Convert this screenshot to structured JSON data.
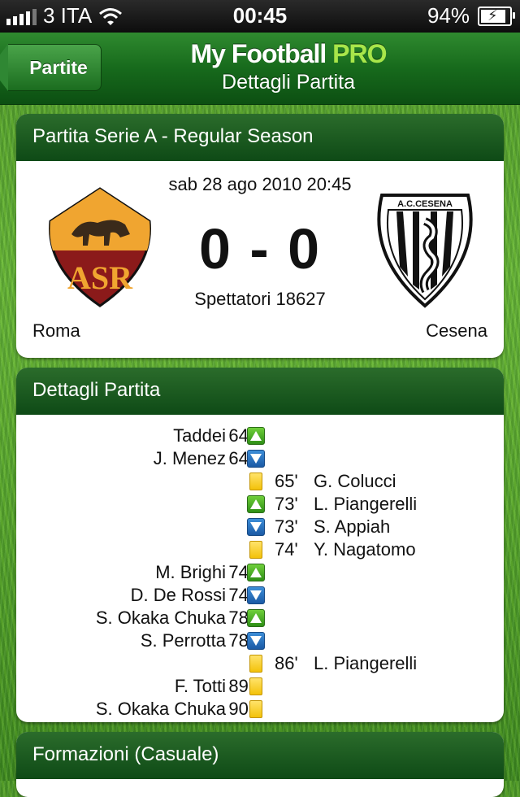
{
  "status_bar": {
    "carrier": "3 ITA",
    "time": "00:45",
    "battery": "94%",
    "battery_level": 0.94
  },
  "nav": {
    "back_label": "Partite",
    "app_name_part1": "My Football",
    "app_name_part2": "PRO",
    "subtitle": "Dettagli Partita"
  },
  "match": {
    "header": "Partita Serie A - Regular Season",
    "date": "sab 28 ago 2010 20:45",
    "score": "0 - 0",
    "spectators": "Spettatori 18627",
    "home_team": "Roma",
    "away_team": "Cesena",
    "away_logo_text": "A.C.CESENA",
    "home_logo_text": "ASR"
  },
  "details": {
    "header": "Dettagli Partita",
    "events": [
      {
        "side": "home",
        "player": "Taddei",
        "minute": "64'",
        "type": "sub-in",
        "icon": "arrow-up-icon"
      },
      {
        "side": "home",
        "player": "J. Menez",
        "minute": "64'",
        "type": "sub-out",
        "icon": "arrow-down-icon"
      },
      {
        "side": "away",
        "player": "G. Colucci",
        "minute": "65'",
        "type": "yellow",
        "icon": "yellow-card-icon"
      },
      {
        "side": "away",
        "player": "L. Piangerelli",
        "minute": "73'",
        "type": "sub-in",
        "icon": "arrow-up-icon"
      },
      {
        "side": "away",
        "player": "S. Appiah",
        "minute": "73'",
        "type": "sub-out",
        "icon": "arrow-down-icon"
      },
      {
        "side": "away",
        "player": "Y. Nagatomo",
        "minute": "74'",
        "type": "yellow",
        "icon": "yellow-card-icon"
      },
      {
        "side": "home",
        "player": "M. Brighi",
        "minute": "74'",
        "type": "sub-in",
        "icon": "arrow-up-icon"
      },
      {
        "side": "home",
        "player": "D. De Rossi",
        "minute": "74'",
        "type": "sub-out",
        "icon": "arrow-down-icon"
      },
      {
        "side": "home",
        "player": "S. Okaka Chuka",
        "minute": "78'",
        "type": "sub-in",
        "icon": "arrow-up-icon"
      },
      {
        "side": "home",
        "player": "S. Perrotta",
        "minute": "78'",
        "type": "sub-out",
        "icon": "arrow-down-icon"
      },
      {
        "side": "away",
        "player": "L. Piangerelli",
        "minute": "86'",
        "type": "yellow",
        "icon": "yellow-card-icon"
      },
      {
        "side": "home",
        "player": "F. Totti",
        "minute": "89'",
        "type": "yellow",
        "icon": "yellow-card-icon"
      },
      {
        "side": "home",
        "player": "S. Okaka Chuka",
        "minute": "90'",
        "type": "yellow",
        "icon": "yellow-card-icon"
      }
    ]
  },
  "lineups": {
    "header": "Formazioni (Casuale)"
  },
  "colors": {
    "header_green": "#0e4a16",
    "brand_pro": "#a8e64a",
    "roma_red": "#8b1a1a",
    "roma_gold": "#f0a530",
    "sub_in": "#2e8f16",
    "sub_out": "#1b5aa5",
    "yellow_card": "#f3c20a"
  }
}
